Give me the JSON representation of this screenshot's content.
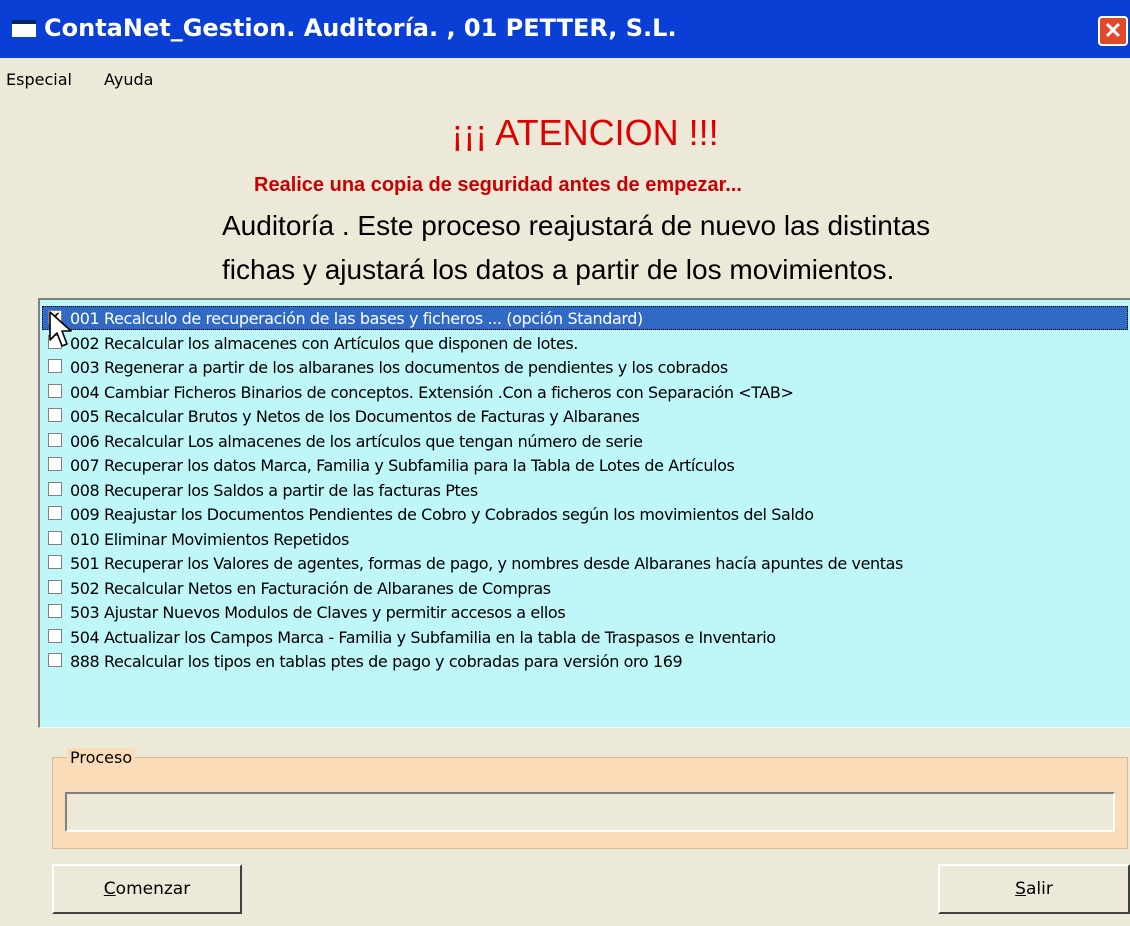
{
  "window": {
    "title": "ContaNet_Gestion. Auditoría. , 01 PETTER, S.L.",
    "close_glyph": "✕"
  },
  "menu": {
    "items": [
      "Especial",
      "Ayuda"
    ]
  },
  "header": {
    "warning": "¡¡¡ ATENCION !!!",
    "backup_notice": "Realice una copia de seguridad antes de empezar...",
    "description_line1": "Auditoría . Este proceso reajustará de nuevo las distintas",
    "description_line2": "fichas y ajustará los datos a partir de los movimientos."
  },
  "options": {
    "selected_index": 0,
    "items": [
      {
        "label": "001 Recalculo de recuperación de las bases y ficheros ... (opción Standard)",
        "checked": true
      },
      {
        "label": "002 Recalcular los almacenes con Artículos que disponen de lotes.",
        "checked": false
      },
      {
        "label": "003 Regenerar a partir de los albaranes los documentos de pendientes y los cobrados",
        "checked": false
      },
      {
        "label": "004 Cambiar Ficheros Binarios de conceptos. Extensión .Con a ficheros con Separación <TAB>",
        "checked": false
      },
      {
        "label": "005 Recalcular Brutos y Netos de los Documentos de Facturas y Albaranes",
        "checked": false
      },
      {
        "label": "006 Recalcular Los almacenes de los artículos que tengan número de serie",
        "checked": false
      },
      {
        "label": "007 Recuperar los datos Marca, Familia y Subfamilia para la Tabla de Lotes de Artículos",
        "checked": false
      },
      {
        "label": "008 Recuperar los Saldos a partir de las facturas Ptes",
        "checked": false
      },
      {
        "label": "009 Reajustar los Documentos Pendientes de Cobro y Cobrados según los movimientos del Saldo",
        "checked": false
      },
      {
        "label": "010 Eliminar Movimientos Repetidos",
        "checked": false
      },
      {
        "label": "501 Recuperar los Valores de agentes, formas de pago, y nombres desde Albaranes hacía apuntes de ventas",
        "checked": false
      },
      {
        "label": "502 Recalcular Netos en Facturación de Albaranes de Compras",
        "checked": false
      },
      {
        "label": "503 Ajustar Nuevos Modulos de Claves y permitir accesos a ellos",
        "checked": false
      },
      {
        "label": "504 Actualizar los Campos Marca - Familia y Subfamilia en la tabla de Traspasos e Inventario",
        "checked": false
      },
      {
        "label": "888 Recalcular los tipos en tablas ptes de pago y cobradas para versión oro 169",
        "checked": false
      }
    ]
  },
  "process": {
    "group_label": "Proceso",
    "progress": 0
  },
  "buttons": {
    "start": {
      "accel": "C",
      "rest": "omenzar"
    },
    "exit": {
      "accel": "S",
      "rest": "alir"
    }
  },
  "colors": {
    "titlebar": "#0a3fd6",
    "warning": "#e00000",
    "list_bg": "#bff6f8",
    "selected": "#316ac5",
    "process_bg": "#fbdcb8"
  }
}
